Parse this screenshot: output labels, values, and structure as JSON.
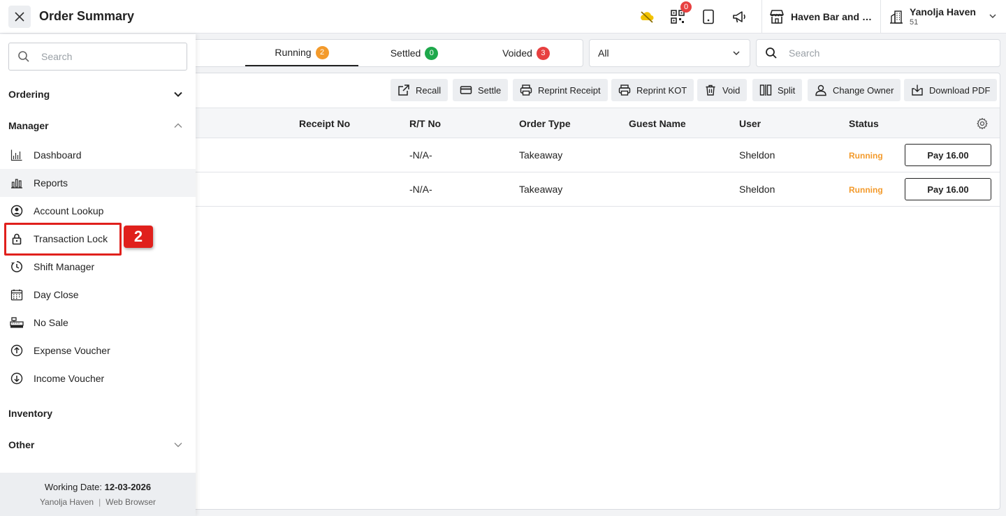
{
  "header": {
    "title": "Order Summary",
    "notification_count": "0",
    "outlet_name": "Haven Bar and Restaurant",
    "account_name": "Yanolja Haven",
    "account_sub": "51"
  },
  "tabs": [
    {
      "label": "Running",
      "count": "2",
      "color": "#f39a2b"
    },
    {
      "label": "Settled",
      "count": "0",
      "color": "#1ea84b"
    },
    {
      "label": "Voided",
      "count": "3",
      "color": "#e74040"
    }
  ],
  "filter": {
    "selected": "All"
  },
  "main_search": {
    "placeholder": "Search"
  },
  "toolbar": {
    "recall": "Recall",
    "settle": "Settle",
    "reprint_receipt": "Reprint Receipt",
    "reprint_kot": "Reprint KOT",
    "void": "Void",
    "split": "Split",
    "change_owner": "Change Owner",
    "download_pdf": "Download PDF"
  },
  "table": {
    "columns": [
      "Receipt No",
      "R/T No",
      "Order Type",
      "Guest Name",
      "User",
      "Status"
    ],
    "rows": [
      {
        "receipt_no": "",
        "rt_no": "-N/A-",
        "order_type": "Takeaway",
        "guest_name": "",
        "user": "Sheldon",
        "status": "Running",
        "action": "Pay 16.00"
      },
      {
        "receipt_no": "",
        "rt_no": "-N/A-",
        "order_type": "Takeaway",
        "guest_name": "",
        "user": "Sheldon",
        "status": "Running",
        "action": "Pay 16.00"
      }
    ]
  },
  "sidebar": {
    "search_placeholder": "Search",
    "sections": {
      "ordering": "Ordering",
      "manager": "Manager",
      "inventory": "Inventory",
      "other": "Other"
    },
    "manager_items": [
      {
        "label": "Dashboard",
        "icon": "chart-icon"
      },
      {
        "label": "Reports",
        "icon": "bar-chart-icon"
      },
      {
        "label": "Account Lookup",
        "icon": "user-circle-icon"
      },
      {
        "label": "Transaction Lock",
        "icon": "lock-icon"
      },
      {
        "label": "Shift Manager",
        "icon": "clock-icon"
      },
      {
        "label": "Day Close",
        "icon": "calendar-icon"
      },
      {
        "label": "No Sale",
        "icon": "cash-register-icon"
      },
      {
        "label": "Expense Voucher",
        "icon": "arrow-up-circle-icon"
      },
      {
        "label": "Income Voucher",
        "icon": "arrow-down-circle-icon"
      }
    ],
    "step_number": "2",
    "footer": {
      "working_date_label": "Working Date:",
      "working_date": "12-03-2026",
      "property": "Yanolja Haven",
      "separator": "|",
      "client": "Web Browser"
    }
  },
  "colors": {
    "running": "#f39a2b",
    "highlight": "#e0201c"
  }
}
